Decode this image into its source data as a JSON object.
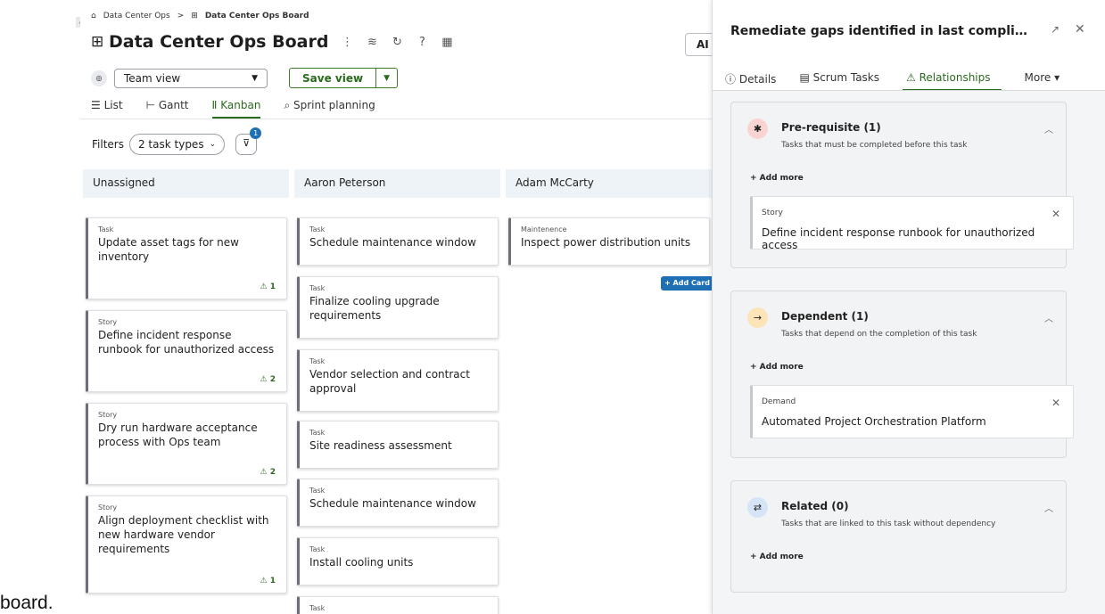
{
  "breadcrumb": {
    "root": "Data Center Ops",
    "separator": ">",
    "current": "Data Center Ops Board"
  },
  "board": {
    "title": "Data Center Ops Board",
    "ai_label": "AI",
    "view_select": "Team view",
    "save_view": "Save view",
    "tabs": [
      "List",
      "Gantt",
      "Kanban",
      "Sprint planning"
    ],
    "active_tab": "Kanban",
    "filters_label": "Filters",
    "filter_pill": "2 task types",
    "filter_badge": "1",
    "add_card": "+ Add Card",
    "columns": [
      {
        "name": "Unassigned",
        "cards": [
          {
            "type": "Task",
            "title": "Update asset tags for new inventory",
            "rel": "1"
          },
          {
            "type": "Story",
            "title": "Define incident response runbook for unauthorized access",
            "rel": "2"
          },
          {
            "type": "Story",
            "title": "Dry run hardware acceptance process with Ops team",
            "rel": "2"
          },
          {
            "type": "Story",
            "title": "Align deployment checklist with new hardware vendor requirements",
            "rel": "1"
          }
        ]
      },
      {
        "name": "Aaron Peterson",
        "cards": [
          {
            "type": "Task",
            "title": "Schedule maintenance window"
          },
          {
            "type": "Task",
            "title": "Finalize cooling upgrade requirements"
          },
          {
            "type": "Task",
            "title": "Vendor selection and contract approval"
          },
          {
            "type": "Task",
            "title": "Site readiness assessment"
          },
          {
            "type": "Task",
            "title": "Schedule maintenance window"
          },
          {
            "type": "Task",
            "title": "Install cooling units"
          },
          {
            "type": "Task",
            "title": ""
          }
        ]
      },
      {
        "name": "Adam McCarty",
        "cards": [
          {
            "type": "Maintenence",
            "title": "Inspect power distribution units"
          }
        ]
      }
    ]
  },
  "stray_text": "board.",
  "panel": {
    "title": "Remediate gaps identified in last compliance revi...",
    "tabs": [
      "Details",
      "Scrum Tasks",
      "Relationships",
      "More"
    ],
    "active_tab": "Relationships",
    "add_more": "+ Add more",
    "sections": [
      {
        "heading": "Pre-requisite (1)",
        "sub": "Tasks that must be completed before this task",
        "icon": "asterisk-icon",
        "color": "#f9d4d1",
        "item": {
          "type": "Story",
          "name": "Define incident response runbook for unauthorized access"
        }
      },
      {
        "heading": "Dependent (1)",
        "sub": "Tasks that depend on the completion of this task",
        "icon": "arrow-right-icon",
        "color": "#fbe4b8",
        "item": {
          "type": "Demand",
          "name": "Automated Project Orchestration Platform"
        }
      },
      {
        "heading": "Related (0)",
        "sub": "Tasks that are linked to this task without dependency",
        "icon": "swap-icon",
        "color": "#d5e4f7"
      }
    ]
  }
}
